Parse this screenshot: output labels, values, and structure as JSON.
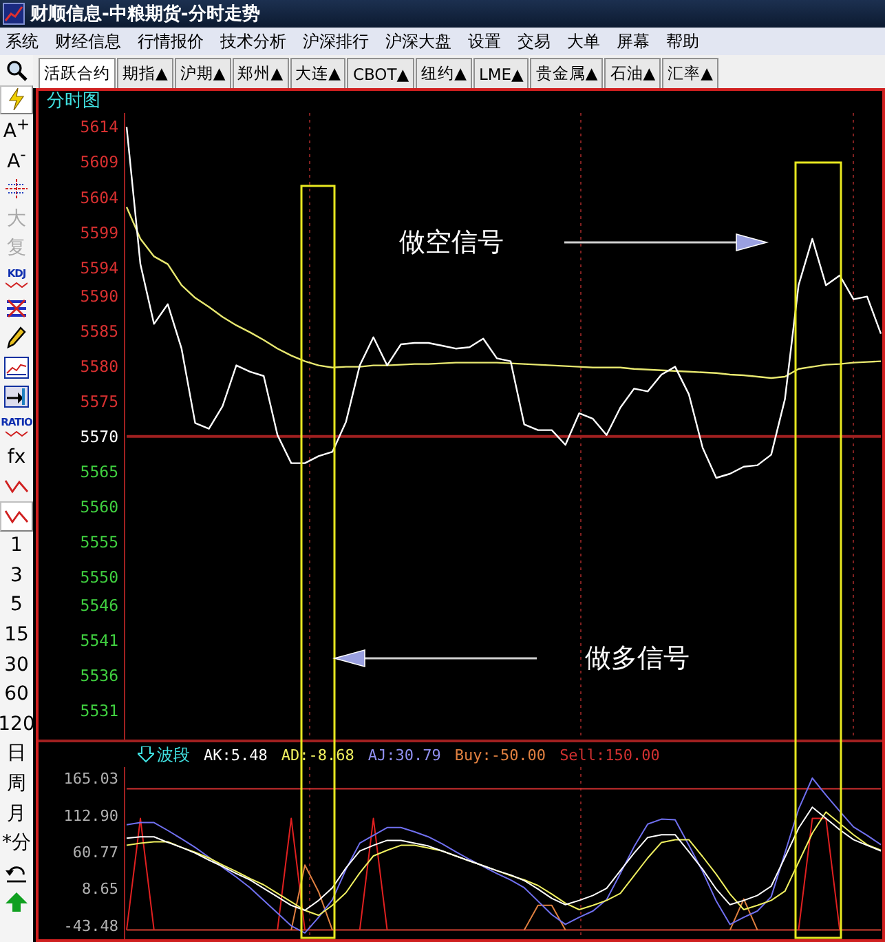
{
  "window": {
    "title": "财顺信息-中粮期货-分时走势"
  },
  "menu": [
    "系统",
    "财经信息",
    "行情报价",
    "技术分析",
    "沪深排行",
    "沪深大盘",
    "设置",
    "交易",
    "大单",
    "屏幕",
    "帮助"
  ],
  "tabs": [
    {
      "label": "活跃合约",
      "selected": true
    },
    {
      "label": "期指▲",
      "selected": false
    },
    {
      "label": "沪期▲",
      "selected": false
    },
    {
      "label": "郑州▲",
      "selected": false
    },
    {
      "label": "大连▲",
      "selected": false
    },
    {
      "label": "CBOT▲",
      "selected": false
    },
    {
      "label": "纽约▲",
      "selected": false
    },
    {
      "label": "LME▲",
      "selected": false
    },
    {
      "label": "贵金属▲",
      "selected": false
    },
    {
      "label": "石油▲",
      "selected": false
    },
    {
      "label": "汇率▲",
      "selected": false
    }
  ],
  "toolbar": [
    {
      "kind": "icon",
      "selected": false
    },
    {
      "kind": "icon",
      "selected": true
    },
    {
      "kind": "text",
      "label": "A$^{+}$",
      "disabled": false,
      "selected": false
    },
    {
      "kind": "text",
      "label": "A$^{-}$",
      "disabled": false,
      "selected": false
    },
    {
      "kind": "icon",
      "selected": false
    },
    {
      "kind": "text",
      "label": "大",
      "disabled": true,
      "selected": false
    },
    {
      "kind": "text",
      "label": "复",
      "disabled": true,
      "selected": false
    },
    {
      "kind": "label",
      "label": "KDJ",
      "selected": false
    },
    {
      "kind": "icon",
      "selected": false
    },
    {
      "kind": "icon",
      "selected": false
    },
    {
      "kind": "icon",
      "selected": false
    },
    {
      "kind": "icon",
      "selected": false
    },
    {
      "kind": "label",
      "label": "RATIO",
      "selected": false
    },
    {
      "kind": "text",
      "label": "fx",
      "disabled": false,
      "selected": false
    },
    {
      "kind": "icon",
      "selected": false
    },
    {
      "kind": "icon",
      "selected": true
    },
    {
      "kind": "text",
      "label": "1",
      "disabled": false,
      "selected": false
    },
    {
      "kind": "text",
      "label": "3",
      "disabled": false,
      "selected": false
    },
    {
      "kind": "text",
      "label": "5",
      "disabled": false,
      "selected": false
    },
    {
      "kind": "text",
      "label": "15",
      "disabled": false,
      "selected": false
    },
    {
      "kind": "text",
      "label": "30",
      "disabled": false,
      "selected": false
    },
    {
      "kind": "text",
      "label": "60",
      "disabled": false,
      "selected": false
    },
    {
      "kind": "text",
      "label": "120",
      "disabled": false,
      "selected": false
    },
    {
      "kind": "text",
      "label": "日",
      "disabled": false,
      "selected": false
    },
    {
      "kind": "text",
      "label": "周",
      "disabled": false,
      "selected": false
    },
    {
      "kind": "text",
      "label": "月",
      "disabled": false,
      "selected": false
    },
    {
      "kind": "text",
      "label": "*分",
      "disabled": false,
      "selected": false
    },
    {
      "kind": "icon",
      "selected": false
    },
    {
      "kind": "icon",
      "selected": false
    }
  ],
  "chart": {
    "title": "分时图",
    "chart_data": {
      "type": "line",
      "ylim": [
        5526.9,
        5616.0
      ],
      "yticks": [
        5614,
        5609,
        5604,
        5599,
        5594,
        5590,
        5585,
        5580,
        5575,
        5570,
        5565,
        5560,
        5555,
        5550,
        5546,
        5541,
        5536,
        5531
      ],
      "series": [
        {
          "color": "#ffffff",
          "values": [
            5614.0,
            5594.5,
            5586.0,
            5588.8,
            5582.5,
            5571.9,
            5571.1,
            5574.3,
            5580.1,
            5579.2,
            5578.6,
            5570.2,
            5566.2,
            5566.2,
            5567.2,
            5567.8,
            5572.1,
            5580.1,
            5584.1,
            5580.1,
            5583.1,
            5583.3,
            5583.3,
            5582.9,
            5582.5,
            5582.7,
            5583.9,
            5581.1,
            5580.7,
            5571.7,
            5570.9,
            5570.9,
            5568.8,
            5573.3,
            5572.5,
            5570.2,
            5574.1,
            5576.8,
            5576.4,
            5578.8,
            5579.9,
            5576.0,
            5568.4,
            5564.1,
            5564.7,
            5565.7,
            5565.9,
            5567.4,
            5575.3,
            5591.5,
            5598.1,
            5591.5,
            5592.9,
            5589.5,
            5589.9,
            5584.6
          ]
        },
        {
          "color": "#e8e870",
          "values": [
            5602.6,
            5598.1,
            5595.6,
            5594.5,
            5591.5,
            5589.7,
            5588.4,
            5587.0,
            5585.8,
            5584.8,
            5583.7,
            5582.5,
            5581.5,
            5580.7,
            5580.1,
            5579.8,
            5579.9,
            5579.9,
            5580.1,
            5580.1,
            5580.2,
            5580.3,
            5580.3,
            5580.4,
            5580.5,
            5580.5,
            5580.5,
            5580.5,
            5580.4,
            5580.3,
            5580.2,
            5580.1,
            5580.0,
            5579.9,
            5579.8,
            5579.8,
            5579.8,
            5579.6,
            5579.5,
            5579.4,
            5579.3,
            5579.2,
            5579.1,
            5579.0,
            5578.8,
            5578.7,
            5578.5,
            5578.3,
            5578.5,
            5579.6,
            5579.9,
            5580.2,
            5580.3,
            5580.5,
            5580.6,
            5580.7
          ]
        },
        {
          "color": "#a02020",
          "values": [
            5570,
            5570,
            5570,
            5570,
            5570,
            5570,
            5570,
            5570,
            5570,
            5570,
            5570,
            5570,
            5570,
            5570,
            5570,
            5570,
            5570,
            5570,
            5570,
            5570,
            5570,
            5570,
            5570,
            5570,
            5570,
            5570,
            5570,
            5570,
            5570,
            5570,
            5570,
            5570,
            5570,
            5570,
            5570,
            5570,
            5570,
            5570,
            5570,
            5570,
            5570,
            5570,
            5570,
            5570,
            5570,
            5570,
            5570,
            5570,
            5570,
            5570,
            5570,
            5570,
            5570,
            5570,
            5570,
            5570
          ]
        }
      ]
    },
    "short_signal": {
      "text": "做空信号"
    },
    "long_signal": {
      "text": "做多信号"
    }
  },
  "indicator": {
    "name": "波段",
    "values": [
      {
        "text": "AK:5.48",
        "color": "#ffffff"
      },
      {
        "text": "AD:-8.68",
        "color": "#f0f060"
      },
      {
        "text": "AJ:30.79",
        "color": "#9090f0"
      },
      {
        "text": "Buy:-50.00",
        "color": "#e08040"
      },
      {
        "text": "Sell:150.00",
        "color": "#d03030"
      }
    ],
    "chart_data": {
      "type": "line",
      "ylim": [
        -62.97,
        180.62
      ],
      "yticks": [
        {
          "value": 165.03,
          "label": "165.03"
        },
        {
          "value": 112.9,
          "label": "112.90"
        },
        {
          "value": 60.77,
          "label": "60.77"
        },
        {
          "value": 8.65,
          "label": "8.65"
        },
        {
          "value": -43.48,
          "label": "-43.48"
        }
      ],
      "series": [
        {
          "color": "#d03030",
          "values": [
            150,
            150,
            150,
            150,
            150,
            150,
            150,
            150,
            150,
            150,
            150,
            150,
            150,
            150,
            150,
            150,
            150,
            150,
            150,
            150,
            150,
            150,
            150,
            150,
            150,
            150,
            150,
            150,
            150,
            150,
            150,
            150,
            150,
            150,
            150,
            150,
            150,
            150,
            150,
            150,
            150,
            150,
            150,
            150,
            150,
            150,
            150,
            150,
            150,
            150,
            150,
            150,
            150,
            150,
            150,
            150
          ]
        },
        {
          "color": "#d04030",
          "values": [
            -50,
            -50,
            -50,
            -50,
            -50,
            -50,
            -50,
            -50,
            -50,
            -50,
            -50,
            -50,
            -50,
            -50,
            -50,
            -50,
            -50,
            -50,
            -50,
            -50,
            -50,
            -50,
            -50,
            -50,
            -50,
            -50,
            -50,
            -50,
            -50,
            -50,
            -50,
            -50,
            -50,
            -50,
            -50,
            -50,
            -50,
            -50,
            -50,
            -50,
            -50,
            -50,
            -50,
            -50,
            -50,
            -50,
            -50,
            -50,
            -50,
            -50,
            -50,
            -50,
            -50,
            -50,
            -50,
            -50
          ]
        },
        {
          "color": "#e02020",
          "values": [
            -50,
            108,
            -50,
            null,
            null,
            null,
            null,
            null,
            null,
            null,
            null,
            -50,
            108,
            -50,
            null,
            null,
            null,
            -50,
            108,
            -50,
            null,
            null,
            null,
            null,
            null,
            null,
            null,
            null,
            null,
            null,
            null,
            null,
            null,
            null,
            null,
            null,
            null,
            null,
            null,
            null,
            null,
            null,
            null,
            null,
            null,
            null,
            null,
            null,
            null,
            -50,
            108,
            108,
            -50,
            null,
            null,
            null
          ]
        },
        {
          "color": "#e08040",
          "values": [
            null,
            null,
            null,
            null,
            null,
            null,
            null,
            null,
            null,
            null,
            null,
            null,
            -50,
            42,
            4,
            -50,
            null,
            null,
            null,
            null,
            null,
            null,
            null,
            null,
            null,
            null,
            null,
            null,
            null,
            -50,
            -15,
            -15,
            -50,
            null,
            null,
            null,
            null,
            null,
            null,
            null,
            null,
            null,
            null,
            null,
            -50,
            -6,
            -50,
            null,
            null,
            null,
            null,
            null,
            null,
            null,
            null,
            null
          ]
        },
        {
          "color": "#7070f0",
          "values": [
            99,
            102,
            102,
            91,
            79,
            67,
            53,
            39,
            25,
            10,
            -8,
            -26,
            -44,
            -54,
            -32,
            -7,
            36,
            73,
            84,
            95,
            95,
            89,
            82,
            72,
            61,
            50,
            40,
            30,
            21,
            10,
            -9,
            -28,
            -42,
            -32,
            -23,
            -7,
            30,
            68,
            100,
            107,
            106,
            70,
            33,
            -9,
            -42,
            -32,
            -23,
            -3,
            59,
            121,
            165,
            141,
            118,
            96,
            84,
            71
          ]
        },
        {
          "color": "#f0f060",
          "values": [
            70,
            73,
            75,
            75,
            67,
            60,
            52,
            42,
            33,
            23,
            14,
            2,
            -10,
            -22,
            -29,
            -15,
            3,
            31,
            55,
            63,
            70,
            70,
            66,
            62,
            55,
            48,
            41,
            34,
            27,
            21,
            13,
            1,
            -12,
            -21,
            -15,
            -8,
            2,
            27,
            52,
            74,
            78,
            78,
            54,
            29,
            1,
            -21,
            -15,
            -8,
            5,
            46,
            87,
            117,
            101,
            85,
            71,
            63
          ]
        },
        {
          "color": "#ffffff",
          "values": [
            80,
            82,
            82,
            74,
            67,
            59,
            49,
            40,
            30,
            21,
            9,
            -3,
            -15,
            -22,
            -8,
            10,
            38,
            62,
            70,
            77,
            77,
            73,
            69,
            62,
            55,
            48,
            41,
            34,
            28,
            20,
            8,
            -5,
            -14,
            -8,
            -1,
            9,
            34,
            59,
            81,
            85,
            85,
            61,
            36,
            8,
            -14,
            -8,
            -1,
            12,
            53,
            94,
            124,
            108,
            92,
            78,
            70,
            62
          ]
        }
      ]
    }
  }
}
